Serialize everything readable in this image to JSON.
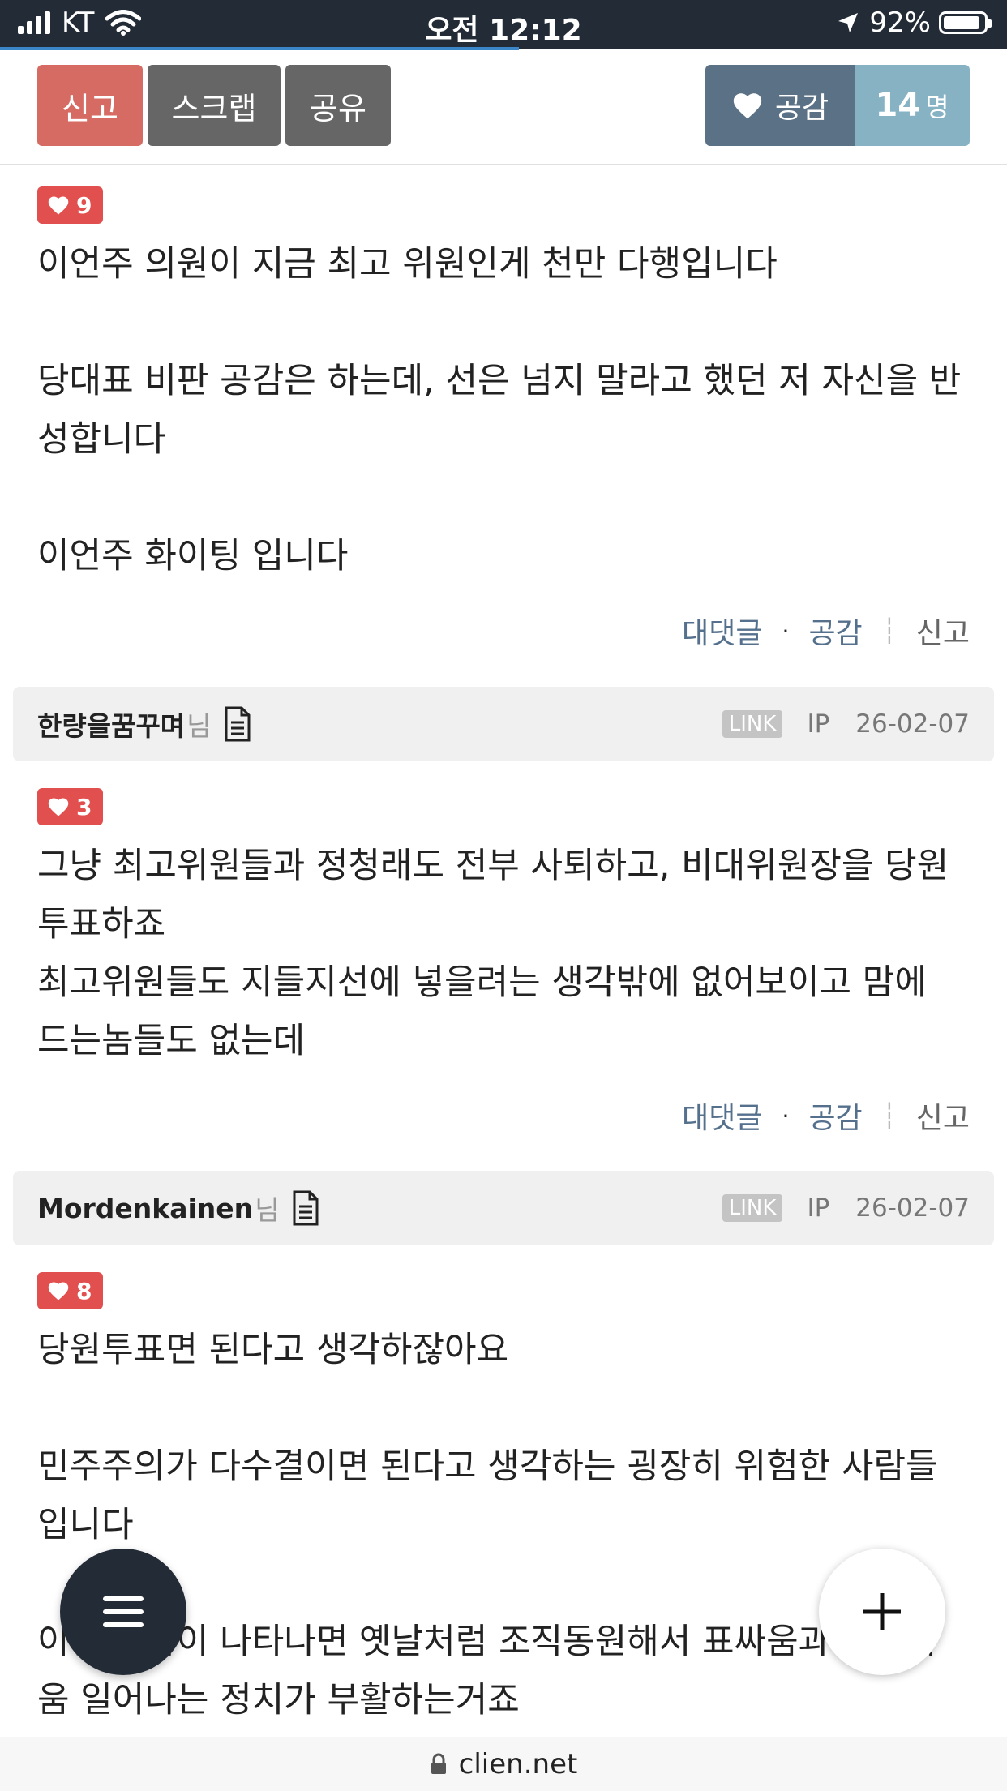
{
  "status_bar": {
    "carrier": "KT",
    "time": "오전 12:12",
    "battery": "92%"
  },
  "action_bar": {
    "report": "신고",
    "scrap": "스크랩",
    "share": "공유",
    "like_label": "공감",
    "like_count": "14",
    "like_unit": "명"
  },
  "comments": [
    {
      "likes": "9",
      "text": "이언주 의원이 지금 최고 위원인게 천만 다행입니다\n\n당대표 비판 공감은 하는데, 선은 넘지 말라고 했던 저 자신을 반성합니다\n\n이언주 화이팅 입니다",
      "reply": "대댓글",
      "like": "공감",
      "report": "신고"
    },
    {
      "author": "한량을꿈꾸며",
      "suffix": "님",
      "link": "LINK",
      "ip": "IP",
      "date": "26-02-07",
      "likes": "3",
      "text": "그냥 최고위원들과 정청래도 전부 사퇴하고, 비대위원장을 당원투표하죠\n최고위원들도 지들지선에 넣을려는 생각밖에 없어보이고 맘에 드는놈들도 없는데",
      "reply": "대댓글",
      "like": "공감",
      "report": "신고"
    },
    {
      "author": "Mordenkainen",
      "suffix": "님",
      "link": "LINK",
      "ip": "IP",
      "date": "26-02-07",
      "likes": "8",
      "text": "당원투표면 된다고 생각하잖아요\n\n민주주의가 다수결이면 된다고 생각하는 굉장히 위험한 사람들입니다\n\n이런 사람이 나타나면 옛날처럼 조직동원해서 표싸움과 계파싸움 일어나는 정치가 부활하는거죠"
    }
  ],
  "bottom_bar": {
    "domain": "clien.net"
  }
}
